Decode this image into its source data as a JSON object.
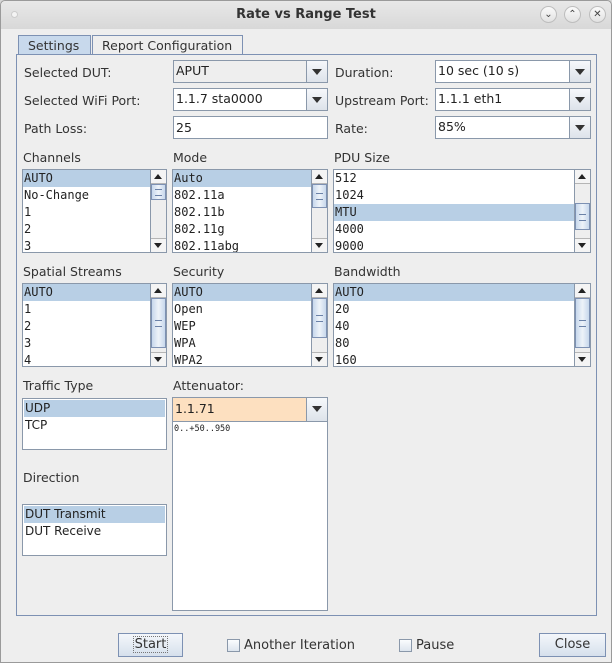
{
  "window": {
    "title": "Rate vs Range Test",
    "controls": [
      "minimize",
      "maximize",
      "close"
    ]
  },
  "tabs": [
    {
      "label": "Settings",
      "active": true
    },
    {
      "label": "Report Configuration",
      "active": false
    }
  ],
  "fields": {
    "selected_dut": {
      "label": "Selected DUT:",
      "value": "APUT"
    },
    "selected_wifi_port": {
      "label": "Selected WiFi Port:",
      "value": "1.1.7 sta0000"
    },
    "path_loss": {
      "label": "Path Loss:",
      "value": "25"
    },
    "duration": {
      "label": "Duration:",
      "value": "10 sec (10 s)"
    },
    "upstream_port": {
      "label": "Upstream Port:",
      "value": "1.1.1 eth1"
    },
    "rate": {
      "label": "Rate:",
      "value": "85%"
    }
  },
  "lists": {
    "channels": {
      "label": "Channels",
      "items": [
        "AUTO",
        "No-Change",
        "1",
        "2",
        "3"
      ],
      "selected": 0
    },
    "mode": {
      "label": "Mode",
      "items": [
        "Auto",
        "802.11a",
        "802.11b",
        "802.11g",
        "802.11abg"
      ],
      "selected": 0
    },
    "pdu_size": {
      "label": "PDU Size",
      "items": [
        "512",
        "1024",
        "MTU",
        "4000",
        "9000"
      ],
      "selected": 2
    },
    "spatial_streams": {
      "label": "Spatial Streams",
      "items": [
        "AUTO",
        "1",
        "2",
        "3",
        "4"
      ],
      "selected": 0
    },
    "security": {
      "label": "Security",
      "items": [
        "AUTO",
        "Open",
        "WEP",
        "WPA",
        "WPA2"
      ],
      "selected": 0
    },
    "bandwidth": {
      "label": "Bandwidth",
      "items": [
        "AUTO",
        "20",
        "40",
        "80",
        "160"
      ],
      "selected": 0
    },
    "traffic_type": {
      "label": "Traffic Type",
      "items": [
        "UDP",
        "TCP"
      ],
      "selected": 0
    },
    "direction": {
      "label": "Direction",
      "items": [
        "DUT Transmit",
        "DUT Receive"
      ],
      "selected": 0
    }
  },
  "attenuator": {
    "label": "Attenuator:",
    "value": "1.1.71",
    "range_text": "0..+50..950",
    "highlight_color": "#fde0c0"
  },
  "footer": {
    "start_label": "Start",
    "another_iteration_label": "Another Iteration",
    "another_iteration_checked": false,
    "pause_label": "Pause",
    "pause_checked": false,
    "close_label": "Close"
  },
  "colors": {
    "selection": "#b8cfe5",
    "tab_active": "#c8d9ec",
    "border": "#7d91b3"
  }
}
